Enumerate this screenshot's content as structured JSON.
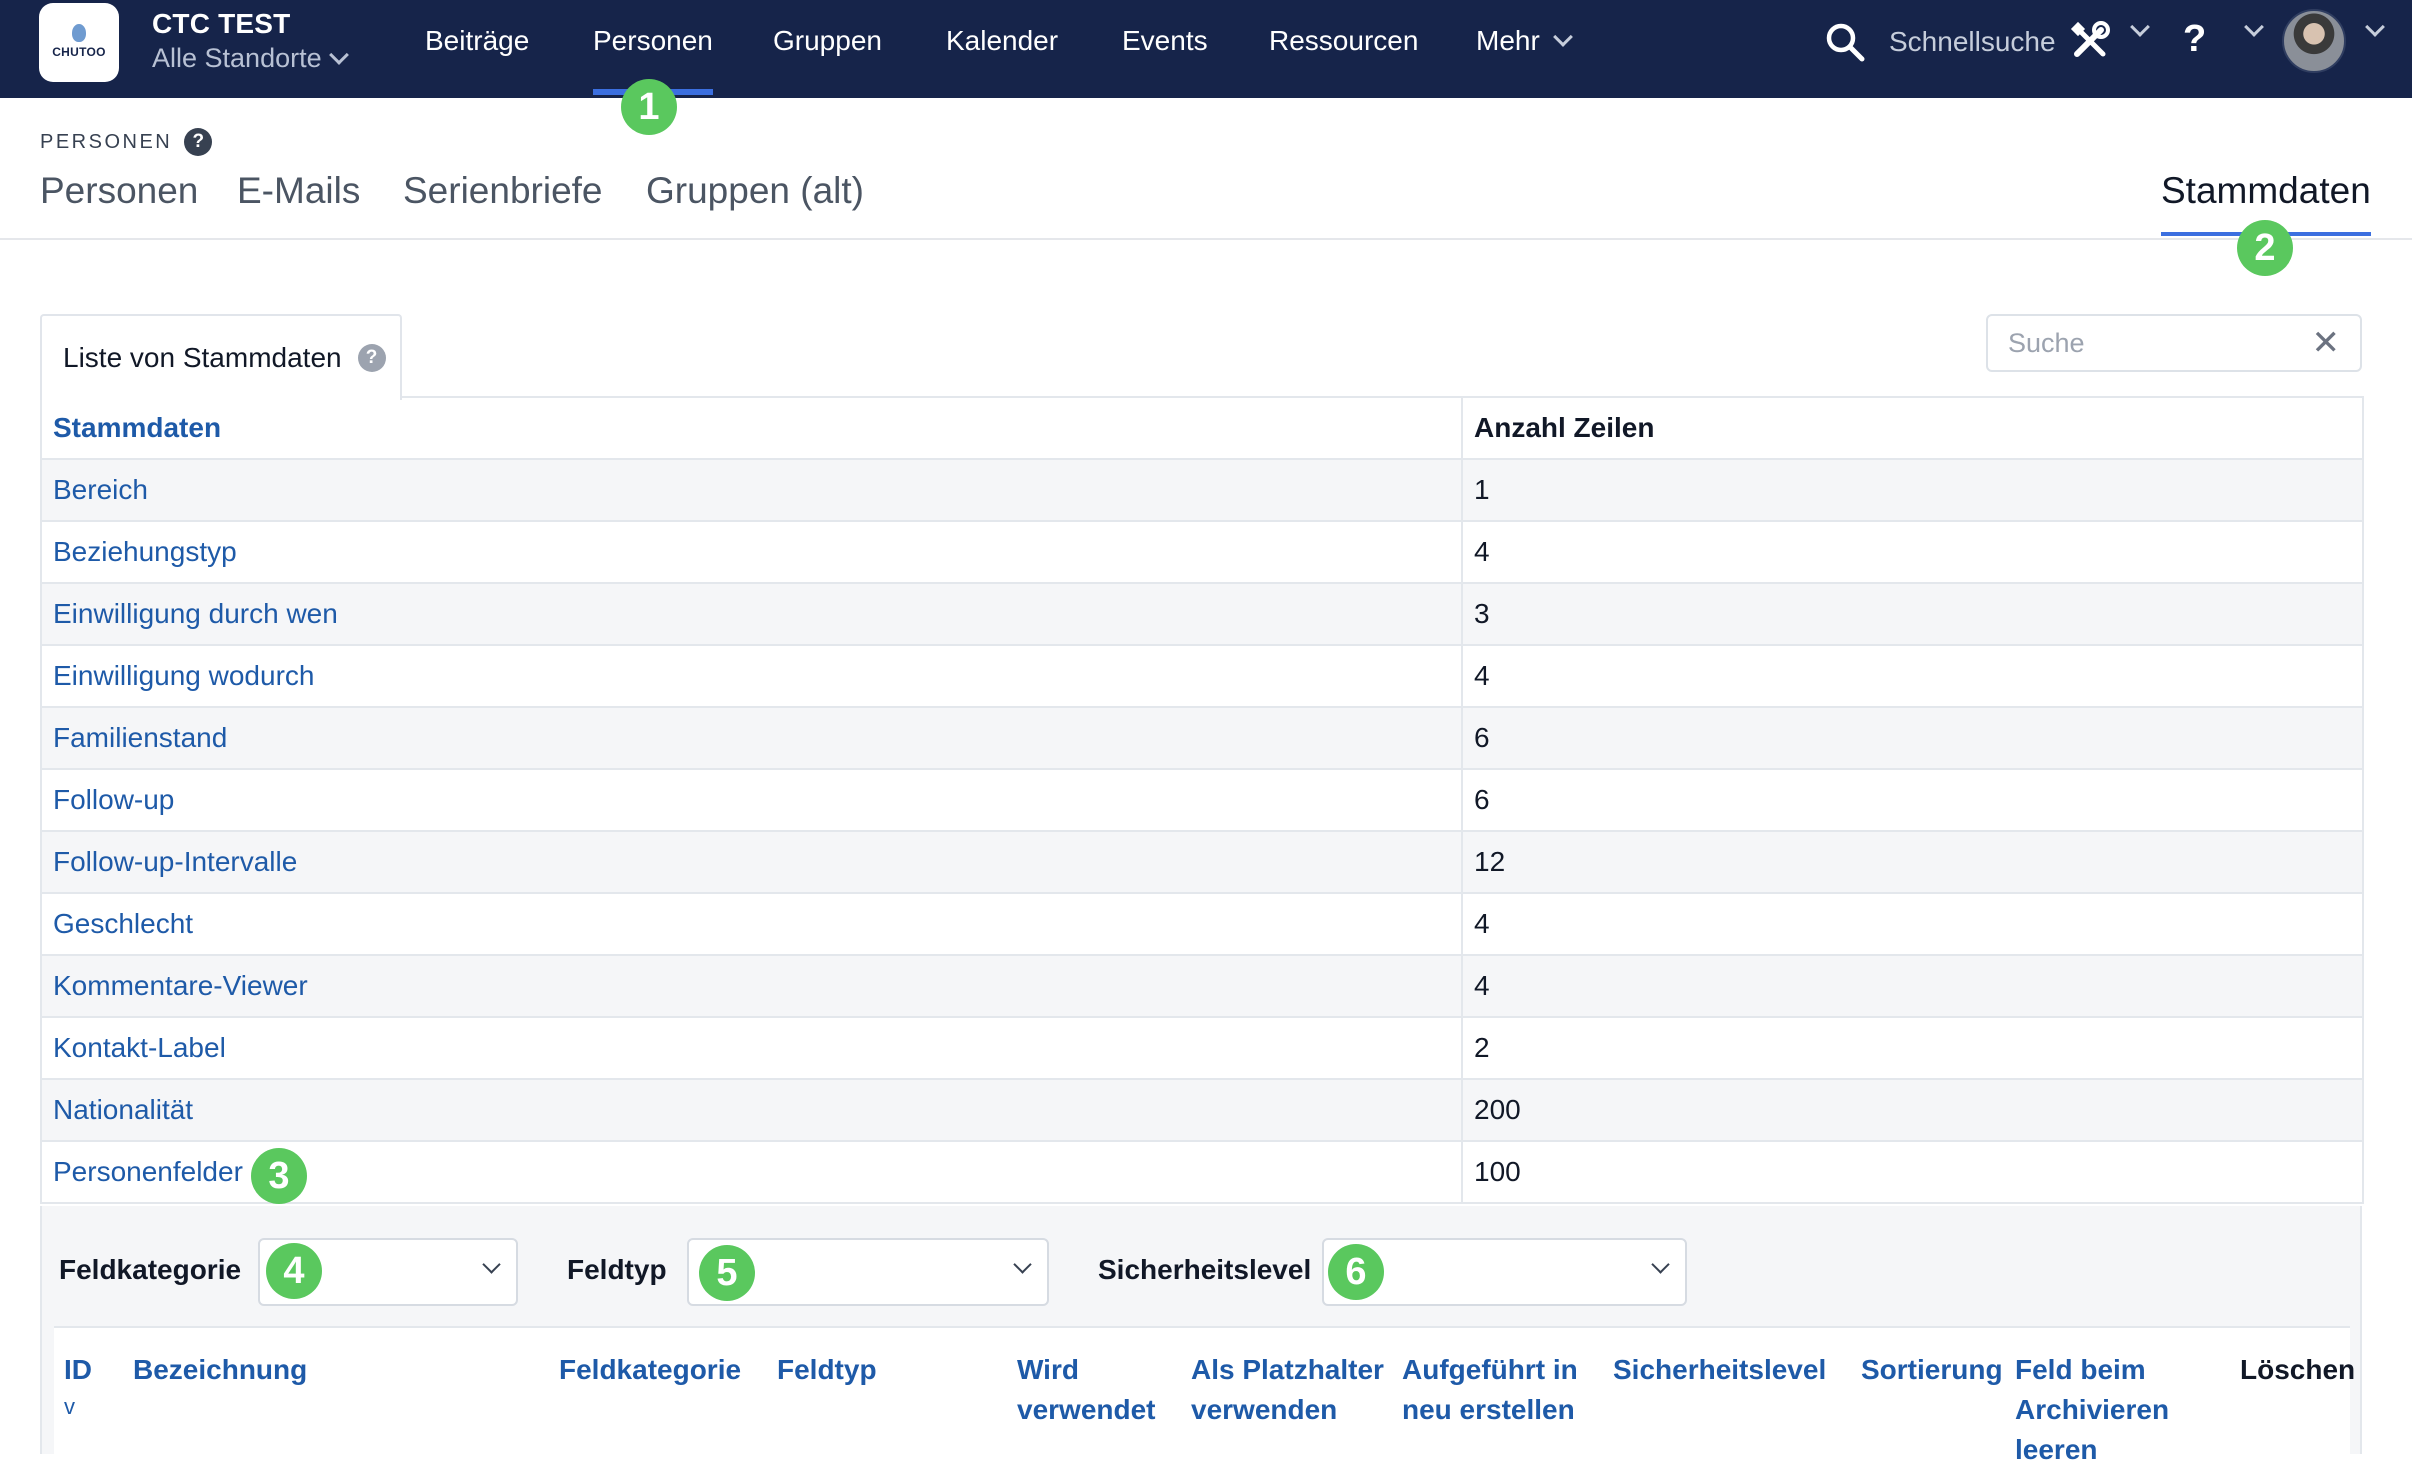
{
  "org": {
    "logo_word": "CHUTOO",
    "title": "CTC TEST",
    "location": "Alle Standorte"
  },
  "nav": {
    "items": [
      "Beiträge",
      "Personen",
      "Gruppen",
      "Kalender",
      "Events",
      "Ressourcen",
      "Mehr"
    ],
    "active": "Personen",
    "search_label": "Schnellsuche",
    "help_label": "?"
  },
  "section": {
    "label": "PERSONEN",
    "help": "?",
    "tabs": [
      "Personen",
      "E-Mails",
      "Serienbriefe",
      "Gruppen (alt)"
    ],
    "right_tab": "Stammdaten"
  },
  "panel": {
    "tab_label": "Liste von Stammdaten",
    "help": "?",
    "search_placeholder": "Suche",
    "clear_symbol": "✕"
  },
  "table": {
    "headers": [
      "Stammdaten",
      "Anzahl Zeilen"
    ],
    "rows": [
      {
        "name": "Bereich",
        "count": "1"
      },
      {
        "name": "Beziehungstyp",
        "count": "4"
      },
      {
        "name": "Einwilligung durch wen",
        "count": "3"
      },
      {
        "name": "Einwilligung wodurch",
        "count": "4"
      },
      {
        "name": "Familienstand",
        "count": "6"
      },
      {
        "name": "Follow-up",
        "count": "6"
      },
      {
        "name": "Follow-up-Intervalle",
        "count": "12"
      },
      {
        "name": "Geschlecht",
        "count": "4"
      },
      {
        "name": "Kommentare-Viewer",
        "count": "4"
      },
      {
        "name": "Kontakt-Label",
        "count": "2"
      },
      {
        "name": "Nationalität",
        "count": "200"
      },
      {
        "name": "Personenfelder",
        "count": "100"
      }
    ]
  },
  "detail": {
    "filters": {
      "kategorie": "Feldkategorie",
      "typ": "Feldtyp",
      "sicherheit": "Sicherheitslevel"
    },
    "columns": {
      "id": "ID",
      "sort_indicator": "v",
      "bezeichnung": "Bezeichnung",
      "feldkategorie": "Feldkategorie",
      "feldtyp": "Feldtyp",
      "wird_1": "Wird",
      "wird_2": "verwendet",
      "platz_1": "Als Platzhalter",
      "platz_2": "verwenden",
      "aufg_1": "Aufgeführt in",
      "aufg_2": "neu erstellen",
      "sicherheitslevel": "Sicherheitslevel",
      "sortierung": "Sortierung",
      "arch_1": "Feld beim",
      "arch_2": "Archivieren",
      "arch_3": "leeren",
      "loeschen": "Löschen"
    }
  },
  "badges": [
    "1",
    "2",
    "3",
    "4",
    "5",
    "6"
  ],
  "colors": {
    "nav_bg": "#16244a",
    "accent": "#3b6fe0",
    "link": "#1e5aa8",
    "badge": "#5ac85e"
  }
}
